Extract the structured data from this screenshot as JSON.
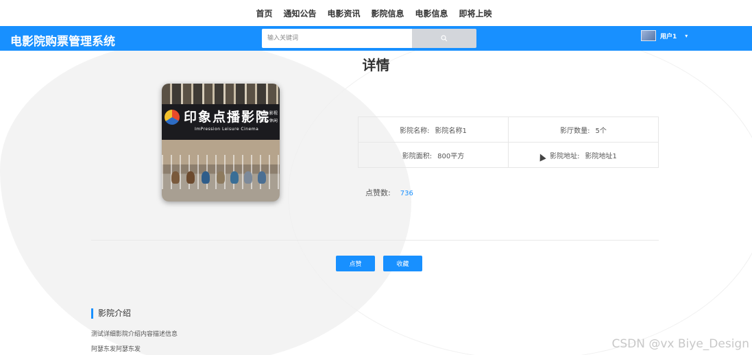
{
  "top_nav": {
    "items": [
      {
        "label": "首页"
      },
      {
        "label": "通知公告"
      },
      {
        "label": "电影资讯"
      },
      {
        "label": "影院信息"
      },
      {
        "label": "电影信息"
      },
      {
        "label": "即将上映"
      }
    ]
  },
  "header": {
    "brand": "电影院购票管理系统",
    "search_placeholder": "输入关键词",
    "user_name": "用户1",
    "accent_color": "#1890ff"
  },
  "detail": {
    "title": "详情",
    "photo": {
      "sign_cn": "印象点播影院",
      "sign_en": "ImPression Leisure Cinema",
      "sign_side_1": "电影 影视",
      "sign_side_2": "聚会 休闲"
    },
    "info": {
      "cinema_name_label": "影院名称:",
      "cinema_name_value": "影院名称1",
      "hall_count_label": "影厅数量:",
      "hall_count_value": "5个",
      "area_label": "影院面积:",
      "area_value": "800平方",
      "address_label": "影院地址:",
      "address_value": "影院地址1"
    },
    "likes_label": "点赞数:",
    "likes_value": "736",
    "like_button": "点赞",
    "favorite_button": "收藏"
  },
  "intro": {
    "section_title": "影院介绍",
    "line1": "测试详细影院介绍内容描述信息",
    "line2": "阿瑟东发阿瑟东发"
  },
  "watermark": "CSDN @vx  Biye_Design"
}
